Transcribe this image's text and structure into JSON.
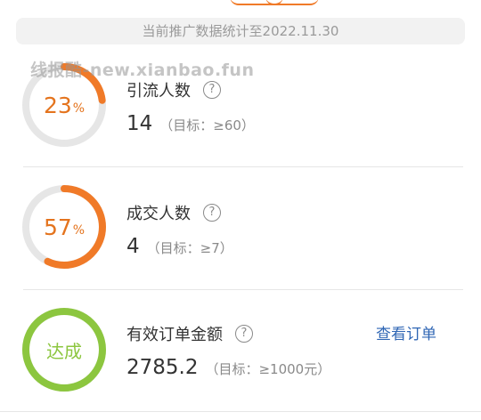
{
  "banner": {
    "text": "当前推广数据统计至2022.11.30"
  },
  "watermark": {
    "text": "线报酷-new.xianbao.fun"
  },
  "metrics": [
    {
      "title": "引流人数",
      "progress_percent": 23,
      "percent_label": "23",
      "percent_sign": "%",
      "value": "14",
      "target": "（目标：≥60）",
      "ring_color": "#f07a28"
    },
    {
      "title": "成交人数",
      "progress_percent": 57,
      "percent_label": "57",
      "percent_sign": "%",
      "value": "4",
      "target": "（目标：≥7）",
      "ring_color": "#f07a28"
    },
    {
      "title": "有效订单金额",
      "progress_percent": 100,
      "status_label": "达成",
      "value": "2785.2",
      "target": "（目标：≥1000元）",
      "ring_color": "#8cc63f",
      "link_label": "查看订单"
    }
  ],
  "help_icon": {
    "glyph": "?"
  },
  "colors": {
    "orange": "#f07a28",
    "track": "#e6e6e6",
    "green": "#8cc63f",
    "link": "#2f66b4"
  }
}
